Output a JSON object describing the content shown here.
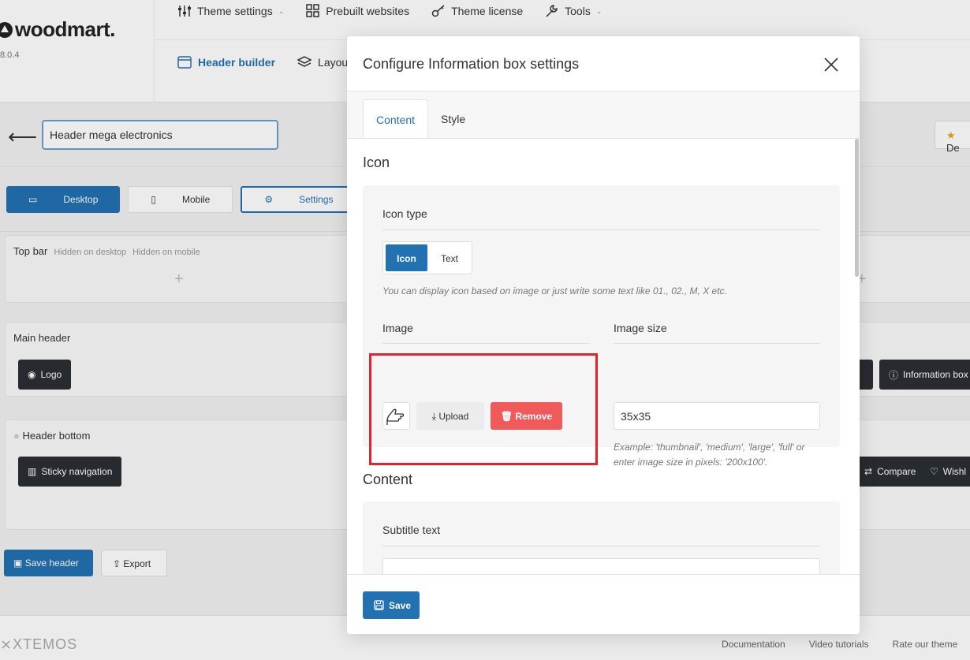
{
  "app": {
    "brand": "woodmart.",
    "version": "8.0.4",
    "top_nav": [
      "Theme settings",
      "Prebuilt websites",
      "Theme license",
      "Tools"
    ],
    "sub_nav": [
      "Header builder",
      "Layou"
    ]
  },
  "builder": {
    "header_name": "Header mega electronics",
    "default_label": "De",
    "device_tabs": [
      "Desktop",
      "Mobile",
      "Settings"
    ],
    "top_bar": {
      "title": "Top bar",
      "hidden_desktop": "Hidden on desktop",
      "hidden_mobile": "Hidden on mobile"
    },
    "main_header": {
      "title": "Main header",
      "left_item": "Logo",
      "right_item": "Information box"
    },
    "header_bottom": {
      "title": "Header bottom",
      "left_item": "Sticky navigation",
      "right_items": [
        "Compare",
        "Wishl"
      ]
    },
    "save_label": "Save header",
    "export_label": "Export"
  },
  "footer": {
    "brand": "XTEMOS",
    "links": [
      "Documentation",
      "Video tutorials",
      "Rate our theme"
    ]
  },
  "modal": {
    "title": "Configure Information box settings",
    "tabs": [
      "Content",
      "Style"
    ],
    "icon_section": {
      "title": "Icon",
      "icon_type_label": "Icon type",
      "icon_type_options": [
        "Icon",
        "Text"
      ],
      "icon_type_selected": "Icon",
      "icon_type_hint": "You can display icon based on image or just write some text like 01., 02., M, X etc.",
      "image_label": "Image",
      "upload_label": "Upload",
      "remove_label": "Remove",
      "image_size_label": "Image size",
      "image_size_value": "35x35",
      "image_size_hint": "Example: 'thumbnail', 'medium', 'large', 'full' or enter image size in pixels: '200x100'."
    },
    "content_section": {
      "title": "Content",
      "subtitle_label": "Subtitle text",
      "subtitle_value": ""
    },
    "save_label": "Save"
  },
  "colors": {
    "accent": "#2271b1",
    "danger": "#f05a5b",
    "highlight": "#e0242b"
  }
}
